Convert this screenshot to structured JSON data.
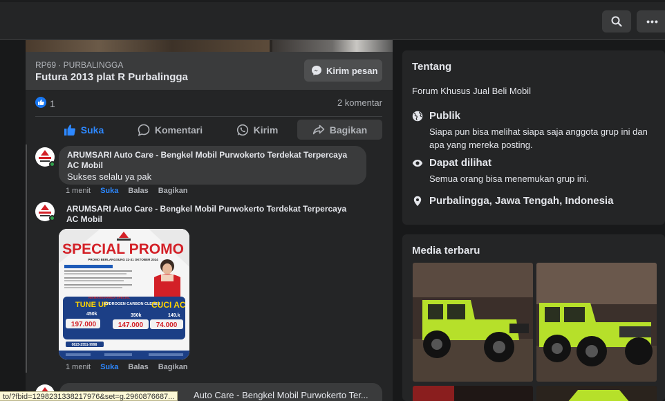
{
  "header": {
    "search_icon": "search-icon",
    "more_icon": "more-icon"
  },
  "post": {
    "listing_meta": "RP69 · PURBALINGGA",
    "listing_title": "Futura 2013 plat R Purbalingga",
    "message_button": "Kirim pesan",
    "like_count": "1",
    "comment_count": "2 komentar",
    "actions": {
      "like": "Suka",
      "comment": "Komentari",
      "send": "Kirim",
      "share": "Bagikan"
    }
  },
  "comments": [
    {
      "author": "ARUMSARI Auto Care - Bengkel Mobil Purwokerto Terdekat Terpercaya AC Mobil",
      "text": "Sukses selalu ya pak",
      "time": "1 menit",
      "like": "Suka",
      "reply": "Balas",
      "share": "Bagikan"
    },
    {
      "author": "ARUMSARI Auto Care - Bengkel Mobil Purwokerto Terdekat Terpercaya AC Mobil",
      "time": "1 menit",
      "like": "Suka",
      "reply": "Balas",
      "share": "Bagikan",
      "image": {
        "title": "SPECIAL PROMO",
        "period": "PROMO BERLANGSUNG 22-31 OKTOBER 2024",
        "services": [
          {
            "name": "TUNE UP",
            "old_price": "450k",
            "price": "197.000"
          },
          {
            "name": "HYDROGEN CARBON CLENER",
            "old_price": "350k",
            "price": "147.000"
          },
          {
            "name": "CUCI AC",
            "old_price": "149.k",
            "price": "74.000"
          }
        ],
        "phone": "0823-2551-9998",
        "special_label": "NIKMATIN HARGA SPECIAL"
      }
    },
    {
      "author_partial": "Auto Care - Bengkel Mobil Purwokerto Ter..."
    }
  ],
  "about": {
    "heading": "Tentang",
    "description": "Forum Khusus Jual Beli Mobil",
    "rows": [
      {
        "icon": "globe-icon",
        "title": "Publik",
        "desc": "Siapa pun bisa melihat siapa saja anggota grup ini dan apa yang mereka posting."
      },
      {
        "icon": "eye-icon",
        "title": "Dapat dilihat",
        "desc": "Semua orang bisa menemukan grup ini."
      },
      {
        "icon": "location-pin-icon",
        "title": "Purbalingga, Jawa Tengah, Indonesia",
        "desc": ""
      }
    ]
  },
  "media": {
    "heading": "Media terbaru"
  },
  "status_url": "to/?fbid=1298231338217976&set=g.2960876687...",
  "colors": {
    "accent": "#2d88ff",
    "jeep_green": "#b6e02a",
    "card_bg": "#242526"
  }
}
